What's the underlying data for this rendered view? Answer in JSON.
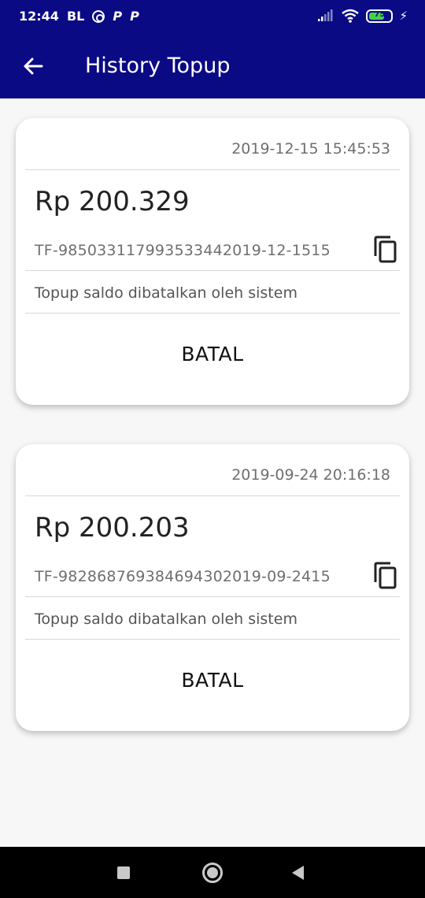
{
  "status_bar": {
    "time": "12:44",
    "carrier": "BL",
    "notif_1": "P",
    "notif_2": "P",
    "battery_level": "75",
    "battery_fraction": 0.75
  },
  "app_bar": {
    "title": "History Topup"
  },
  "transactions": [
    {
      "date": "2019-12-15 15:45:53",
      "amount": "Rp 200.329",
      "id": "TF-985033117993533442019-12-1515",
      "note": "Topup saldo dibatalkan oleh sistem",
      "status": "BATAL"
    },
    {
      "date": "2019-09-24 20:16:18",
      "amount": "Rp 200.203",
      "id": "TF-982868769384694302019-09-2415",
      "note": "Topup saldo dibatalkan oleh sistem",
      "status": "BATAL"
    }
  ],
  "colors": {
    "primary": "#0a0a84",
    "card_bg": "#ffffff",
    "page_bg": "#f7f7f7",
    "battery_fill": "#47d147"
  },
  "icons": [
    "back-arrow-icon",
    "copy-icon",
    "wifi-icon",
    "signal-icon",
    "battery-icon",
    "charging-icon",
    "sync-icon"
  ]
}
